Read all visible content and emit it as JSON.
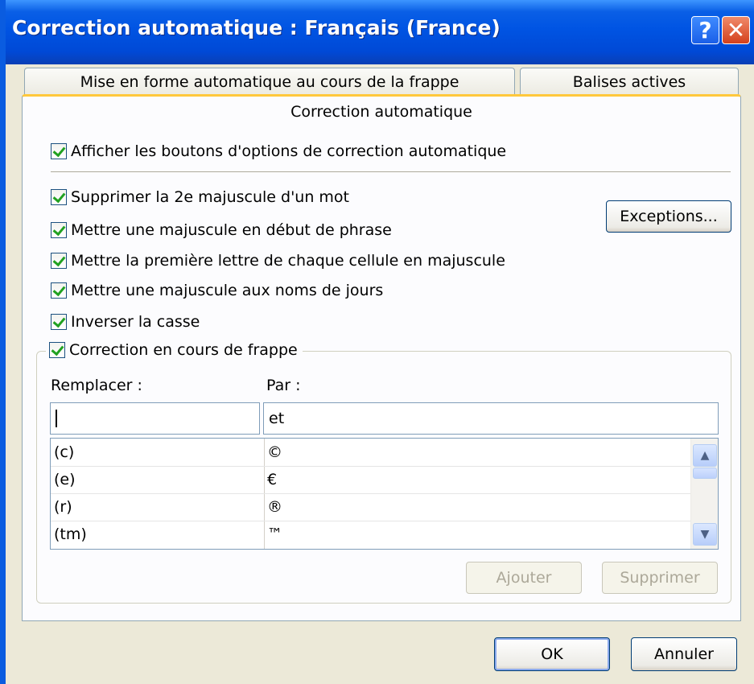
{
  "window": {
    "title": "Correction automatique : Français (France)"
  },
  "titlebar_buttons": {
    "help": "?",
    "close": "✕"
  },
  "tabs": [
    {
      "label": "Mise en forme automatique au cours de la frappe"
    },
    {
      "label": "Balises actives"
    },
    {
      "label": "Correction automatique",
      "active": true
    }
  ],
  "checkboxes": {
    "show_buttons": {
      "label": "Afficher les boutons d'options de correction automatique",
      "checked": true
    },
    "two_initial_caps": {
      "label": "Supprimer la 2e majuscule d'un mot",
      "checked": true
    },
    "capitalize_sentence": {
      "label": "Mettre une majuscule en début de phrase",
      "checked": true
    },
    "capitalize_cell": {
      "label": "Mettre la première lettre de chaque cellule en majuscule",
      "checked": true
    },
    "capitalize_days": {
      "label": "Mettre une majuscule aux noms de jours",
      "checked": true
    },
    "caps_lock": {
      "label": "Inverser la casse",
      "checked": true
    },
    "replace_as_type": {
      "label": "Correction en cours de frappe",
      "checked": true
    }
  },
  "buttons": {
    "exceptions": "Exceptions...",
    "ajouter": "Ajouter",
    "supprimer": "Supprimer",
    "ok": "OK",
    "annuler": "Annuler"
  },
  "replace": {
    "remplacer_label": "Remplacer :",
    "par_label": "Par :",
    "remplacer_value": "",
    "par_value": "et",
    "entries": [
      {
        "from": "(c)",
        "to": "©"
      },
      {
        "from": "(e)",
        "to": "€"
      },
      {
        "from": "(r)",
        "to": "®"
      },
      {
        "from": "(tm)",
        "to": "™"
      }
    ]
  },
  "colors": {
    "titlebar": "#0054e3",
    "dialog_bg": "#ece9d8",
    "tab_accent": "#ffc83c",
    "check": "#21a121"
  }
}
